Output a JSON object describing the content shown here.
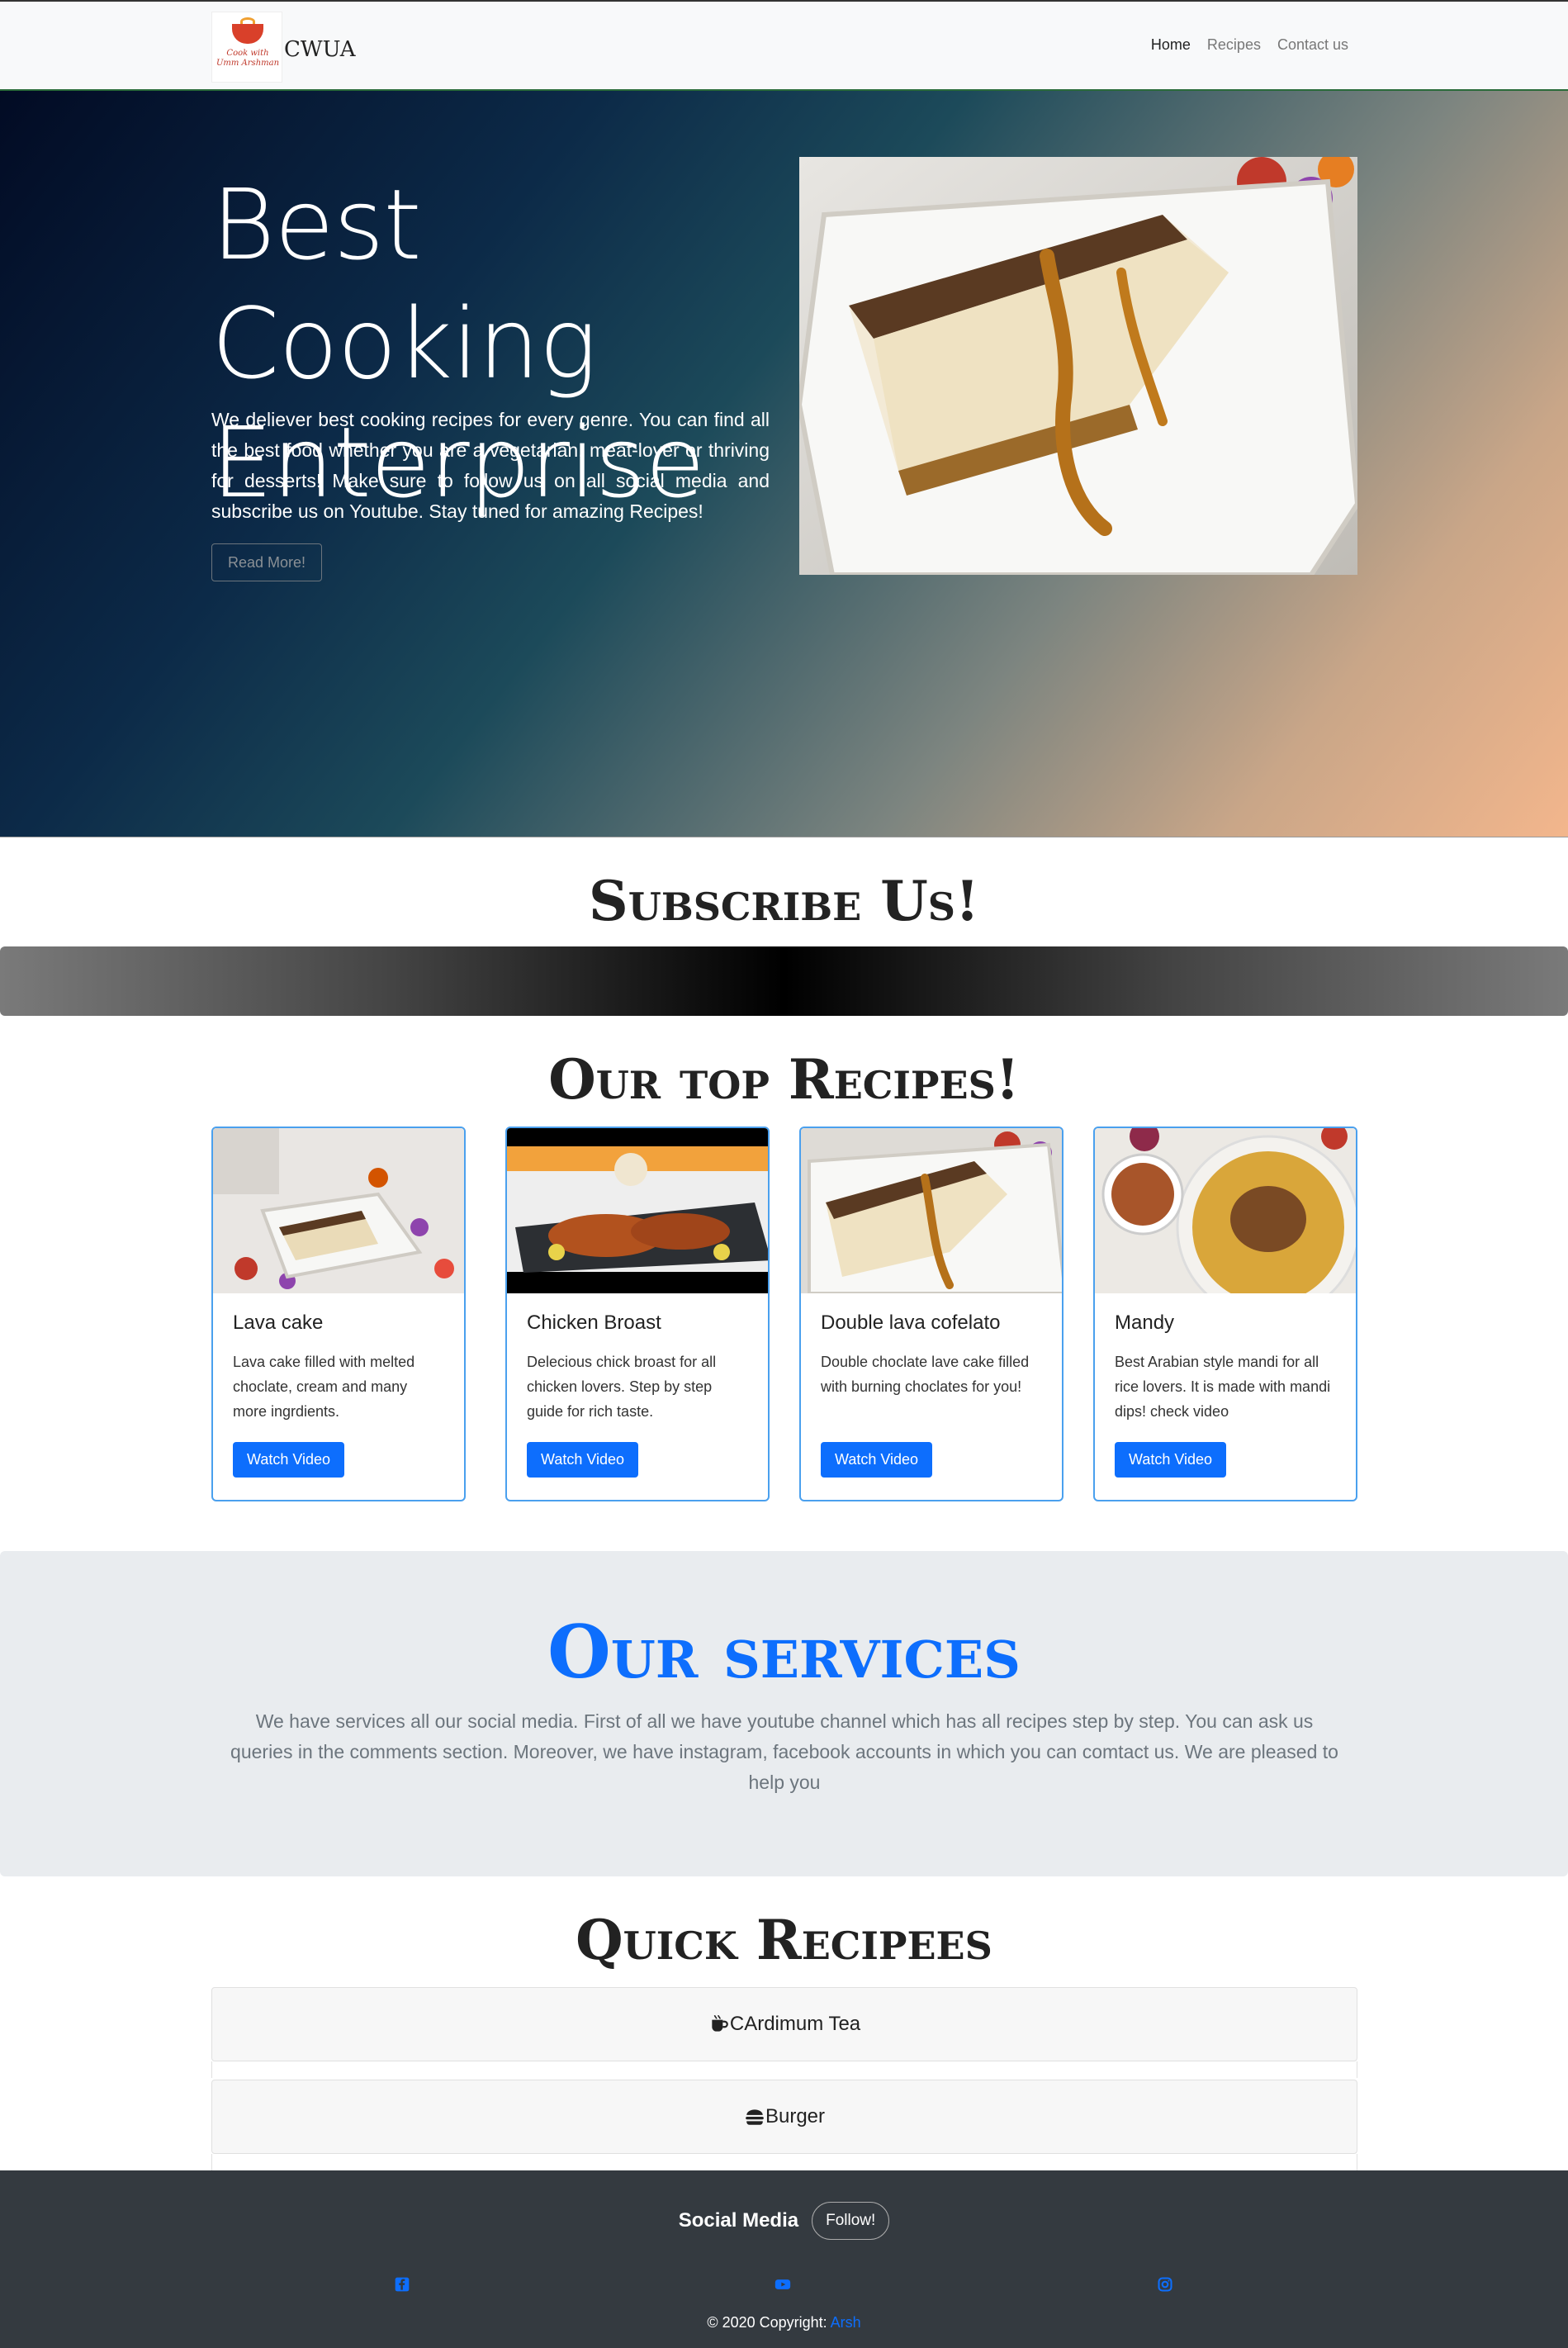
{
  "navbar": {
    "brand": "CWUA",
    "logo_text": "Cook with Umm Arshman",
    "links": [
      "Home",
      "Recipes",
      "Contact us"
    ]
  },
  "hero": {
    "title": "Best Cooking Enterprise",
    "text": "We deliever best cooking recipes for every genre. You can find all the best food whether you are a vegetarian, meat-lover or thriving for desserts! Make sure to follow us on all social media and subscribe us on Youtube. Stay tuned for amazing Recipes!",
    "button": "Read More!"
  },
  "subscribe": {
    "title": "Subscribe Us!"
  },
  "recipes": {
    "title": "Our top Recipes!",
    "cards": [
      {
        "title": "Lava cake",
        "text": "Lava cake filled with melted choclate, cream and many more ingrdients.",
        "button": "Watch Video"
      },
      {
        "title": "Chicken Broast",
        "text": "Delecious chick broast for all chicken lovers. Step by step guide for rich taste.",
        "button": "Watch Video"
      },
      {
        "title": "Double lava cofelato",
        "text": "Double choclate lave cake filled with burning choclates for you!",
        "button": "Watch Video"
      },
      {
        "title": "Mandy",
        "text": "Best Arabian style mandi for all rice lovers. It is made with mandi dips! check video",
        "button": "Watch Video"
      }
    ]
  },
  "services": {
    "title": "Our services",
    "text": "We have services all our social media. First of all we have youtube channel which has all recipes step by step. You can ask us queries in the comments section. Moreover, we have instagram, facebook accounts in which you can comtact us. We are pleased to help you"
  },
  "quick": {
    "title": "Quick Recipees",
    "items": [
      {
        "label": "CArdimum Tea",
        "icon": "coffee-cup-icon"
      },
      {
        "label": "Burger",
        "icon": "burger-icon"
      }
    ]
  },
  "footer": {
    "label": "Social Media",
    "button": "Follow!",
    "icons": [
      "facebook-icon",
      "youtube-icon",
      "instagram-icon"
    ],
    "copyright": "© 2020 Copyright: ",
    "copyright_link": "Arsh",
    "icon_color": "#0d6efd"
  }
}
